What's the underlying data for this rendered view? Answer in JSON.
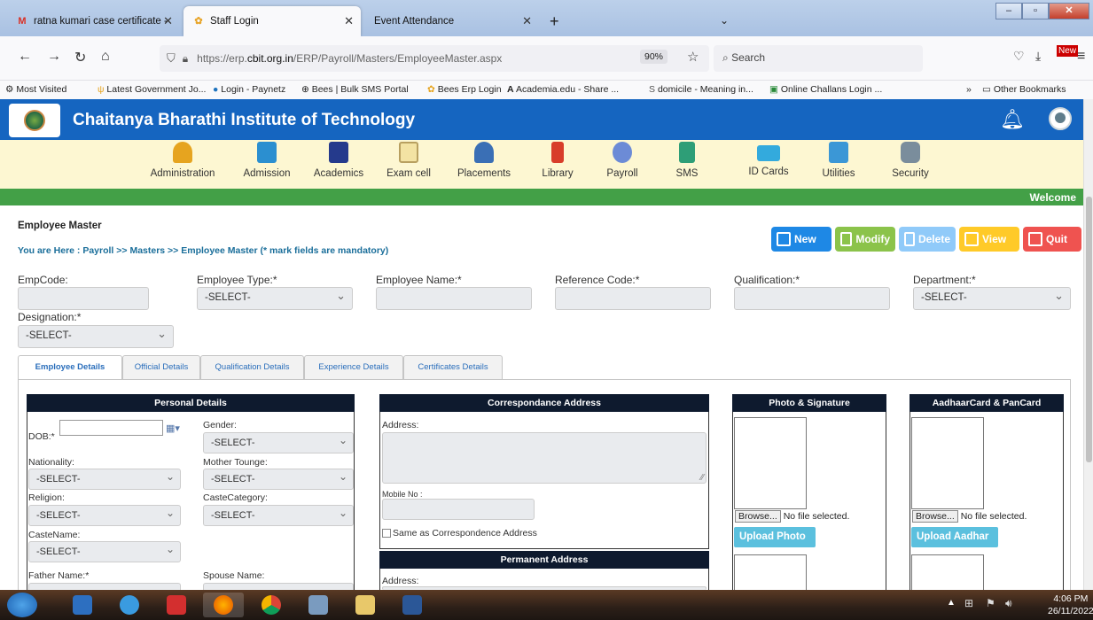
{
  "browser": {
    "tabs": [
      {
        "label": "ratna kumari case certificate - a",
        "icon": "gmail-icon"
      },
      {
        "label": "Staff Login",
        "icon": "bees-icon",
        "active": true
      },
      {
        "label": "Event Attendance"
      }
    ],
    "url_prefix": "https://erp.",
    "url_domain": "cbit.org.in",
    "url_path": "/ERP/Payroll/Masters/EmployeeMaster.aspx",
    "zoom": "90%",
    "search_placeholder": "Search",
    "bookmarks": [
      "Most Visited",
      "Latest Government Jo...",
      "Login - Paynetz",
      "Bees | Bulk SMS Portal",
      "Bees Erp Login",
      "Academia.edu - Share ...",
      "domicile - Meaning in...",
      "Online Challans Login ..."
    ],
    "other_bookmarks": "Other Bookmarks"
  },
  "site": {
    "title": "Chaitanya Bharathi Institute of Technology",
    "welcome": "Welcome"
  },
  "menu": [
    {
      "label": "Administration",
      "color": "#e6a41f"
    },
    {
      "label": "Admission",
      "color": "#2b8fd0"
    },
    {
      "label": "Academics",
      "color": "#253a8c"
    },
    {
      "label": "Exam cell",
      "color": "#d8c67c"
    },
    {
      "label": "Placements",
      "color": "#3a6fb5"
    },
    {
      "label": "Library",
      "color": "#d83d2a"
    },
    {
      "label": "Payroll",
      "color": "#6c8bd6"
    },
    {
      "label": "SMS",
      "color": "#2e9e77"
    },
    {
      "label": "ID Cards",
      "color": "#33aadd"
    },
    {
      "label": "Utilities",
      "color": "#3b97d6"
    },
    {
      "label": "Security",
      "color": "#7a8d9c"
    }
  ],
  "page": {
    "title": "Employee Master",
    "breadcrumb": "You are Here : Payroll >> Masters >> Employee Master (* mark fields are mandatory)",
    "actions": [
      {
        "label": "New",
        "color": "#1e88e5"
      },
      {
        "label": "Modify",
        "color": "#8bc34a"
      },
      {
        "label": "Delete",
        "color": "#90caf9"
      },
      {
        "label": "View",
        "color": "#ffca28"
      },
      {
        "label": "Quit",
        "color": "#ef5350"
      }
    ]
  },
  "form": {
    "empcode": "EmpCode:",
    "employee_type": "Employee Type:*",
    "employee_name": "Employee Name:*",
    "reference_code": "Reference Code:*",
    "qualification": "Qualification:*",
    "department": "Department:*",
    "designation": "Designation:*",
    "select": "-SELECT-"
  },
  "tabs": [
    "Employee Details",
    "Official Details",
    "Qualification Details",
    "Experience Details",
    "Certificates Details"
  ],
  "personal": {
    "header": "Personal Details",
    "dob": "DOB:*",
    "gender": "Gender:",
    "nationality": "Nationality:",
    "mother_tongue": "Mother Tounge:",
    "religion": "Religion:",
    "caste_category": "CasteCategory:",
    "caste_name": "CasteName:",
    "father_name": "Father Name:*",
    "spouse_name": "Spouse Name:",
    "select": "-SELECT-"
  },
  "correspondence": {
    "header": "Correspondance Address",
    "address": "Address:",
    "mobile": "Mobile No :",
    "same_as": "Same as Correspondence Address"
  },
  "permanent": {
    "header": "Permanent Address",
    "address": "Address:"
  },
  "photo": {
    "header": "Photo & Signature",
    "browse": "Browse...",
    "no_file": "No file selected.",
    "upload": "Upload Photo"
  },
  "aadhar": {
    "header": "AadhaarCard & PanCard",
    "browse": "Browse...",
    "no_file": "No file selected.",
    "upload": "Upload Aadhar"
  },
  "taskbar": {
    "time": "4:06 PM",
    "date": "26/11/2022"
  }
}
